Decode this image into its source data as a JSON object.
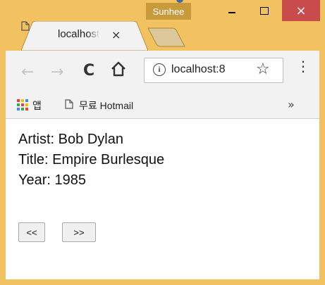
{
  "window": {
    "profile_name": "Sunhee",
    "controls": {
      "minimize": "",
      "maximize": "",
      "close": "×"
    }
  },
  "tab": {
    "title": "localhost",
    "close_glyph": "×"
  },
  "toolbar": {
    "back_glyph": "←",
    "forward_glyph": "→",
    "reload_glyph": "C",
    "home_glyph": "⌂",
    "url": "localhost:8",
    "info_glyph": "i",
    "star_glyph": "☆",
    "menu_glyph": "⋮"
  },
  "bookmarks": {
    "apps_label": "앱",
    "items": [
      {
        "label": "무료 Hotmail"
      }
    ],
    "overflow_glyph": "»"
  },
  "content": {
    "artist": "Artist: Bob Dylan",
    "title": "Title: Empire Burlesque",
    "year": "Year: 1985",
    "prev_label": "<<",
    "next_label": ">>"
  },
  "colors": {
    "frame": "#f1c25f",
    "close_button": "#c94b4b",
    "profile_badge": "#c89a3c",
    "toolbar": "#f2f2f2"
  }
}
